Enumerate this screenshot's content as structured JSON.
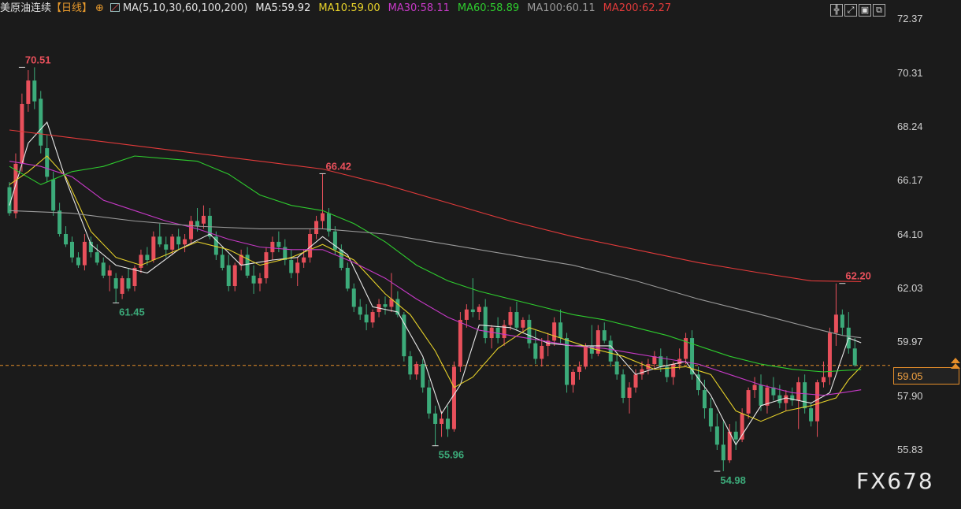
{
  "header": {
    "symbol": "美原油连续",
    "period": "【日线】",
    "period_icon": "crosshair-circle-icon",
    "ma_icon": "chart-thumbnail-icon",
    "ma_label": "MA(5,10,30,60,100,200)",
    "ma5": "MA5:59.92",
    "ma10": "MA10:59.00",
    "ma30": "MA30:58.11",
    "ma60": "MA60:58.89",
    "ma100": "MA100:60.11",
    "ma200": "MA200:62.27"
  },
  "toolbar": {
    "icons": [
      "crosshair-icon",
      "zoom-region-icon",
      "chart-window-icon",
      "maximize-icon"
    ],
    "glyphs": [
      "╬",
      "⤢",
      "▣",
      "⧉"
    ]
  },
  "colors": {
    "background": "#1b1b1b",
    "up": "#e8505b",
    "down": "#3cab7a",
    "ma5": "#e8e8e8",
    "ma10": "#e6d12a",
    "ma30": "#c639c6",
    "ma60": "#2ecc2e",
    "ma100": "#9a9a9a",
    "ma200": "#e03a3a",
    "current_price_line": "#e58e2a"
  },
  "axis": {
    "labels": [
      "72.37",
      "70.31",
      "68.24",
      "66.17",
      "64.10",
      "62.03",
      "59.97",
      "57.90",
      "55.83"
    ],
    "current_price": "59.05"
  },
  "chart_data": {
    "type": "candlestick",
    "ylim": [
      54.5,
      72.5
    ],
    "current_price": 59.05,
    "annotations": [
      {
        "text": "70.51",
        "value": 70.51,
        "index": 2,
        "kind": "high"
      },
      {
        "text": "61.45",
        "value": 61.45,
        "index": 17,
        "kind": "low"
      },
      {
        "text": "66.42",
        "value": 66.42,
        "index": 50,
        "kind": "high"
      },
      {
        "text": "55.96",
        "value": 55.96,
        "index": 68,
        "kind": "low"
      },
      {
        "text": "54.98",
        "value": 54.98,
        "index": 113,
        "kind": "low"
      },
      {
        "text": "62.20",
        "value": 62.2,
        "index": 133,
        "kind": "high"
      }
    ],
    "ohlc": [
      [
        65.9,
        66.1,
        64.8,
        64.9
      ],
      [
        64.9,
        67.2,
        64.7,
        66.8
      ],
      [
        66.8,
        69.5,
        66.5,
        69.1
      ],
      [
        69.1,
        70.4,
        68.8,
        70.0
      ],
      [
        70.0,
        70.51,
        68.9,
        69.2
      ],
      [
        69.3,
        69.6,
        67.2,
        67.5
      ],
      [
        67.4,
        67.9,
        66.1,
        66.3
      ],
      [
        66.2,
        66.5,
        64.8,
        65.0
      ],
      [
        65.0,
        65.3,
        64.0,
        64.1
      ],
      [
        64.1,
        64.4,
        63.6,
        63.7
      ],
      [
        63.8,
        64.0,
        63.0,
        63.2
      ],
      [
        63.2,
        63.4,
        62.8,
        62.9
      ],
      [
        62.9,
        64.1,
        62.7,
        63.8
      ],
      [
        63.8,
        64.0,
        63.2,
        63.4
      ],
      [
        63.4,
        63.7,
        62.9,
        63.0
      ],
      [
        63.0,
        63.2,
        62.4,
        62.5
      ],
      [
        62.5,
        62.9,
        61.9,
        62.7
      ],
      [
        62.4,
        62.6,
        61.45,
        62.0
      ],
      [
        61.8,
        62.5,
        61.6,
        62.4
      ],
      [
        62.4,
        62.8,
        61.9,
        62.0
      ],
      [
        62.1,
        62.9,
        61.9,
        62.8
      ],
      [
        62.8,
        63.5,
        62.6,
        63.3
      ],
      [
        63.3,
        63.6,
        62.9,
        63.1
      ],
      [
        63.1,
        64.2,
        63.0,
        64.0
      ],
      [
        64.0,
        64.5,
        63.6,
        63.7
      ],
      [
        63.7,
        64.0,
        63.2,
        63.5
      ],
      [
        63.5,
        64.1,
        63.3,
        64.0
      ],
      [
        64.0,
        64.3,
        63.5,
        63.7
      ],
      [
        63.7,
        64.1,
        63.4,
        63.9
      ],
      [
        63.9,
        64.8,
        63.7,
        64.6
      ],
      [
        64.6,
        65.1,
        64.2,
        64.4
      ],
      [
        64.5,
        65.2,
        64.3,
        64.8
      ],
      [
        64.8,
        65.1,
        63.9,
        64.0
      ],
      [
        64.0,
        64.2,
        63.1,
        63.3
      ],
      [
        63.3,
        63.6,
        62.7,
        62.8
      ],
      [
        62.9,
        63.3,
        61.9,
        62.1
      ],
      [
        62.1,
        63.0,
        61.9,
        62.9
      ],
      [
        62.9,
        63.5,
        62.7,
        63.3
      ],
      [
        63.3,
        63.6,
        62.4,
        62.5
      ],
      [
        62.5,
        62.9,
        61.8,
        62.2
      ],
      [
        62.2,
        62.6,
        61.9,
        62.4
      ],
      [
        62.4,
        63.6,
        62.2,
        63.4
      ],
      [
        63.4,
        64.0,
        63.1,
        63.8
      ],
      [
        63.8,
        64.2,
        63.4,
        63.6
      ],
      [
        63.6,
        63.9,
        62.9,
        63.1
      ],
      [
        63.1,
        63.5,
        62.4,
        62.6
      ],
      [
        62.6,
        63.2,
        62.1,
        63.0
      ],
      [
        63.0,
        63.5,
        62.8,
        63.2
      ],
      [
        63.2,
        64.3,
        63.0,
        64.1
      ],
      [
        64.1,
        64.8,
        63.9,
        64.6
      ],
      [
        64.6,
        66.42,
        64.3,
        64.9
      ],
      [
        64.9,
        65.1,
        64.0,
        64.2
      ],
      [
        64.2,
        64.4,
        63.3,
        63.5
      ],
      [
        63.5,
        63.7,
        62.7,
        62.8
      ],
      [
        62.8,
        63.0,
        61.9,
        62.0
      ],
      [
        62.0,
        62.2,
        61.1,
        61.3
      ],
      [
        61.3,
        61.6,
        60.8,
        61.0
      ],
      [
        61.0,
        61.4,
        60.4,
        60.7
      ],
      [
        60.7,
        61.2,
        60.5,
        61.1
      ],
      [
        61.1,
        61.6,
        60.9,
        61.4
      ],
      [
        61.4,
        61.7,
        61.0,
        61.3
      ],
      [
        61.3,
        62.6,
        61.1,
        61.6
      ],
      [
        61.6,
        61.9,
        60.9,
        61.0
      ],
      [
        61.0,
        61.1,
        59.2,
        59.4
      ],
      [
        59.4,
        59.6,
        58.5,
        58.7
      ],
      [
        58.7,
        59.2,
        58.5,
        59.1
      ],
      [
        59.1,
        59.3,
        58.0,
        58.2
      ],
      [
        58.2,
        58.5,
        57.0,
        57.2
      ],
      [
        57.2,
        57.5,
        55.96,
        56.8
      ],
      [
        56.8,
        57.3,
        56.3,
        57.0
      ],
      [
        57.0,
        57.5,
        56.3,
        56.6
      ],
      [
        56.6,
        59.2,
        56.5,
        59.0
      ],
      [
        59.0,
        61.1,
        58.8,
        60.8
      ],
      [
        60.8,
        61.4,
        60.5,
        61.2
      ],
      [
        61.2,
        62.4,
        60.9,
        61.1
      ],
      [
        61.1,
        61.4,
        60.8,
        61.3
      ],
      [
        61.3,
        61.6,
        59.9,
        60.1
      ],
      [
        60.1,
        60.6,
        59.7,
        60.5
      ],
      [
        60.5,
        60.9,
        59.9,
        60.1
      ],
      [
        60.1,
        60.8,
        59.8,
        60.6
      ],
      [
        60.6,
        61.3,
        60.4,
        61.1
      ],
      [
        61.1,
        61.5,
        60.4,
        60.5
      ],
      [
        60.5,
        60.9,
        60.3,
        60.8
      ],
      [
        60.8,
        61.0,
        59.7,
        59.9
      ],
      [
        59.9,
        60.4,
        59.1,
        59.3
      ],
      [
        59.3,
        60.1,
        59.0,
        59.8
      ],
      [
        59.8,
        60.3,
        59.4,
        60.0
      ],
      [
        60.0,
        60.9,
        59.8,
        60.7
      ],
      [
        60.7,
        61.2,
        59.9,
        60.1
      ],
      [
        60.1,
        60.3,
        58.0,
        58.3
      ],
      [
        58.3,
        58.9,
        58.0,
        58.8
      ],
      [
        58.8,
        59.2,
        58.5,
        59.0
      ],
      [
        59.0,
        59.9,
        58.9,
        59.8
      ],
      [
        59.8,
        60.6,
        59.3,
        59.5
      ],
      [
        59.5,
        60.6,
        59.4,
        60.4
      ],
      [
        60.4,
        60.7,
        59.9,
        60.0
      ],
      [
        60.0,
        60.2,
        59.0,
        59.2
      ],
      [
        59.2,
        59.5,
        58.5,
        58.7
      ],
      [
        58.7,
        58.9,
        57.6,
        57.8
      ],
      [
        57.8,
        58.4,
        57.2,
        58.2
      ],
      [
        58.2,
        58.9,
        58.0,
        58.7
      ],
      [
        58.7,
        59.2,
        58.5,
        58.9
      ],
      [
        58.9,
        59.3,
        58.7,
        59.1
      ],
      [
        59.1,
        59.6,
        58.9,
        59.4
      ],
      [
        59.4,
        59.7,
        58.8,
        59.0
      ],
      [
        59.0,
        59.4,
        58.4,
        58.6
      ],
      [
        58.6,
        59.2,
        58.3,
        59.1
      ],
      [
        59.1,
        59.7,
        58.9,
        59.3
      ],
      [
        59.3,
        60.3,
        59.1,
        60.1
      ],
      [
        60.1,
        60.4,
        58.5,
        58.7
      ],
      [
        58.7,
        59.0,
        57.9,
        58.1
      ],
      [
        58.1,
        58.5,
        57.0,
        57.4
      ],
      [
        57.4,
        57.8,
        56.5,
        56.7
      ],
      [
        56.7,
        57.2,
        55.8,
        56.0
      ],
      [
        56.0,
        56.9,
        54.98,
        55.4
      ],
      [
        55.4,
        56.8,
        55.3,
        56.5
      ],
      [
        56.5,
        56.9,
        55.8,
        56.2
      ],
      [
        56.2,
        57.4,
        56.1,
        57.2
      ],
      [
        57.2,
        58.2,
        57.0,
        58.1
      ],
      [
        58.1,
        58.6,
        57.8,
        58.3
      ],
      [
        58.3,
        58.7,
        57.3,
        57.5
      ],
      [
        57.5,
        58.3,
        57.2,
        58.2
      ],
      [
        58.2,
        58.6,
        57.7,
        57.9
      ],
      [
        57.9,
        58.3,
        57.4,
        57.6
      ],
      [
        57.6,
        58.1,
        57.3,
        57.9
      ],
      [
        57.9,
        58.2,
        57.5,
        57.7
      ],
      [
        57.7,
        58.6,
        56.6,
        58.4
      ],
      [
        58.4,
        58.7,
        57.2,
        57.4
      ],
      [
        57.4,
        57.6,
        56.7,
        56.9
      ],
      [
        56.9,
        58.5,
        56.3,
        58.4
      ],
      [
        58.4,
        59.2,
        58.2,
        58.6
      ],
      [
        58.6,
        60.5,
        58.3,
        60.3
      ],
      [
        60.3,
        62.2,
        59.8,
        61.0
      ],
      [
        61.0,
        61.2,
        60.2,
        60.5
      ],
      [
        60.5,
        61.1,
        59.5,
        59.7
      ],
      [
        59.7,
        60.1,
        59.0,
        59.05
      ]
    ],
    "ma": {
      "ma5": [
        [
          0,
          65.2
        ],
        [
          3,
          67.6
        ],
        [
          6,
          68.4
        ],
        [
          9,
          66.2
        ],
        [
          13,
          63.7
        ],
        [
          17,
          62.9
        ],
        [
          22,
          62.6
        ],
        [
          27,
          63.5
        ],
        [
          32,
          64.1
        ],
        [
          37,
          62.9
        ],
        [
          42,
          63.1
        ],
        [
          46,
          63.2
        ],
        [
          50,
          64.0
        ],
        [
          54,
          63.3
        ],
        [
          58,
          61.3
        ],
        [
          62,
          61.1
        ],
        [
          66,
          59.4
        ],
        [
          69,
          57.2
        ],
        [
          72,
          58.3
        ],
        [
          75,
          60.6
        ],
        [
          80,
          60.5
        ],
        [
          86,
          59.9
        ],
        [
          90,
          59.8
        ],
        [
          96,
          59.8
        ],
        [
          100,
          58.7
        ],
        [
          104,
          59.0
        ],
        [
          108,
          59.2
        ],
        [
          112,
          57.9
        ],
        [
          116,
          56.0
        ],
        [
          120,
          57.5
        ],
        [
          124,
          57.8
        ],
        [
          128,
          57.6
        ],
        [
          131,
          58.0
        ],
        [
          134,
          60.1
        ],
        [
          136,
          59.92
        ]
      ],
      "ma10": [
        [
          0,
          66.0
        ],
        [
          3,
          66.5
        ],
        [
          6,
          67.1
        ],
        [
          9,
          66.3
        ],
        [
          13,
          64.2
        ],
        [
          17,
          63.2
        ],
        [
          21,
          62.9
        ],
        [
          25,
          63.3
        ],
        [
          30,
          63.8
        ],
        [
          35,
          63.5
        ],
        [
          40,
          62.9
        ],
        [
          45,
          63.2
        ],
        [
          50,
          63.7
        ],
        [
          55,
          63.1
        ],
        [
          60,
          61.8
        ],
        [
          64,
          61.0
        ],
        [
          68,
          59.6
        ],
        [
          71,
          58.2
        ],
        [
          74,
          58.6
        ],
        [
          78,
          59.7
        ],
        [
          83,
          60.5
        ],
        [
          88,
          60.1
        ],
        [
          93,
          59.7
        ],
        [
          98,
          59.4
        ],
        [
          103,
          58.9
        ],
        [
          108,
          59.0
        ],
        [
          112,
          58.7
        ],
        [
          116,
          57.3
        ],
        [
          120,
          56.9
        ],
        [
          124,
          57.3
        ],
        [
          128,
          57.5
        ],
        [
          132,
          57.8
        ],
        [
          134,
          58.5
        ],
        [
          136,
          59.0
        ]
      ],
      "ma30": [
        [
          0,
          66.9
        ],
        [
          5,
          66.7
        ],
        [
          10,
          66.3
        ],
        [
          15,
          65.4
        ],
        [
          20,
          65.0
        ],
        [
          25,
          64.6
        ],
        [
          30,
          64.3
        ],
        [
          35,
          63.9
        ],
        [
          40,
          63.6
        ],
        [
          45,
          63.5
        ],
        [
          50,
          63.5
        ],
        [
          55,
          63.0
        ],
        [
          60,
          62.4
        ],
        [
          65,
          61.6
        ],
        [
          70,
          60.9
        ],
        [
          75,
          60.4
        ],
        [
          80,
          60.2
        ],
        [
          85,
          60.0
        ],
        [
          90,
          59.8
        ],
        [
          95,
          59.7
        ],
        [
          100,
          59.5
        ],
        [
          105,
          59.3
        ],
        [
          110,
          59.1
        ],
        [
          115,
          58.7
        ],
        [
          120,
          58.3
        ],
        [
          125,
          58.0
        ],
        [
          130,
          57.9
        ],
        [
          133,
          58.0
        ],
        [
          136,
          58.11
        ]
      ],
      "ma60": [
        [
          0,
          66.7
        ],
        [
          5,
          66.0
        ],
        [
          10,
          66.5
        ],
        [
          15,
          66.7
        ],
        [
          20,
          67.1
        ],
        [
          25,
          67.0
        ],
        [
          30,
          66.9
        ],
        [
          35,
          66.4
        ],
        [
          40,
          65.6
        ],
        [
          45,
          65.2
        ],
        [
          50,
          65.0
        ],
        [
          55,
          64.5
        ],
        [
          60,
          63.8
        ],
        [
          65,
          62.9
        ],
        [
          70,
          62.3
        ],
        [
          75,
          61.9
        ],
        [
          80,
          61.6
        ],
        [
          85,
          61.3
        ],
        [
          90,
          61.0
        ],
        [
          95,
          60.8
        ],
        [
          100,
          60.5
        ],
        [
          105,
          60.2
        ],
        [
          110,
          59.8
        ],
        [
          115,
          59.4
        ],
        [
          120,
          59.1
        ],
        [
          125,
          58.9
        ],
        [
          130,
          58.8
        ],
        [
          133,
          58.85
        ],
        [
          136,
          58.89
        ]
      ],
      "ma100": [
        [
          0,
          65.0
        ],
        [
          10,
          64.9
        ],
        [
          20,
          64.6
        ],
        [
          30,
          64.4
        ],
        [
          40,
          64.3
        ],
        [
          50,
          64.3
        ],
        [
          60,
          64.1
        ],
        [
          70,
          63.7
        ],
        [
          80,
          63.3
        ],
        [
          90,
          62.9
        ],
        [
          100,
          62.3
        ],
        [
          110,
          61.6
        ],
        [
          120,
          61.0
        ],
        [
          128,
          60.5
        ],
        [
          133,
          60.2
        ],
        [
          136,
          60.11
        ]
      ],
      "ma200": [
        [
          0,
          68.1
        ],
        [
          10,
          67.8
        ],
        [
          20,
          67.5
        ],
        [
          30,
          67.2
        ],
        [
          40,
          66.9
        ],
        [
          50,
          66.6
        ],
        [
          60,
          66.0
        ],
        [
          70,
          65.3
        ],
        [
          80,
          64.6
        ],
        [
          90,
          64.0
        ],
        [
          100,
          63.5
        ],
        [
          110,
          63.0
        ],
        [
          120,
          62.6
        ],
        [
          128,
          62.3
        ],
        [
          133,
          62.28
        ],
        [
          136,
          62.27
        ]
      ]
    }
  },
  "watermark": "FX678"
}
